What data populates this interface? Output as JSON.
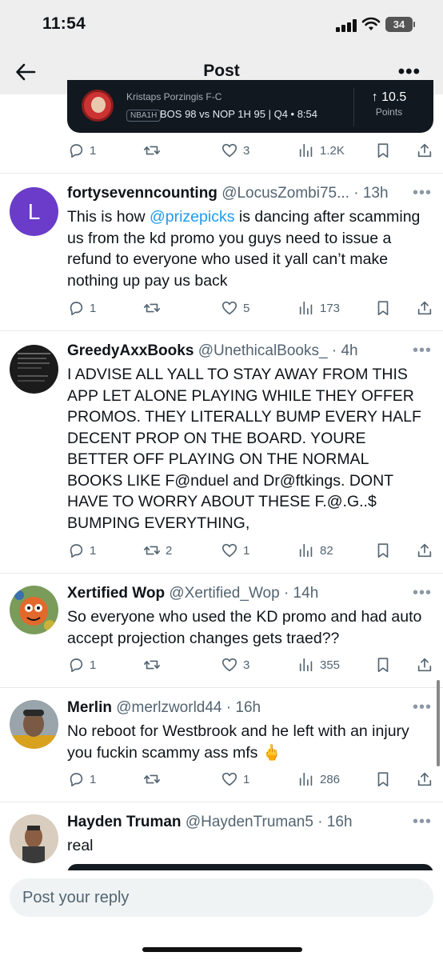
{
  "status": {
    "time": "11:54",
    "battery": "34"
  },
  "nav": {
    "title": "Post"
  },
  "card": {
    "player": "Kristaps Porzingis F-C",
    "league": "NBA1H",
    "score": "BOS 98 vs NOP 1H 95 | Q4 • 8:54",
    "line": "↑ 10.5",
    "unit": "Points"
  },
  "top_actions": {
    "replies": "1",
    "reposts": "",
    "likes": "3",
    "views": "1.2K"
  },
  "tweets": [
    {
      "name": "fortysevenncounting",
      "handle": "@LocusZombi75... · 13h",
      "avatar_letter": "L",
      "body_pre": "This is how ",
      "mention": "@prizepicks",
      "body_post": " is dancing after scamming us from the kd promo you guys need to issue a refund to everyone who used it yall can’t make nothing up pay us back",
      "replies": "1",
      "reposts": "",
      "likes": "5",
      "views": "173"
    },
    {
      "name": "GreedyAxxBooks",
      "handle": "@UnethicalBooks_ · 4h",
      "body": "I ADVISE ALL YALL TO STAY AWAY FROM THIS APP LET ALONE PLAYING WHILE THEY OFFER PROMOS. THEY LITERALLY BUMP EVERY HALF DECENT PROP ON THE BOARD. YOURE BETTER OFF PLAYING ON THE NORMAL BOOKS LIKE F@nduel and Dr@ftkings. DONT HAVE TO WORRY ABOUT THESE F.@.G..$  BUMPING EVERYTHING,",
      "replies": "1",
      "reposts": "2",
      "likes": "1",
      "views": "82"
    },
    {
      "name": "Xertified Wop",
      "handle": "@Xertified_Wop · 14h",
      "body": "So everyone who used the KD promo and had auto accept projection changes gets traed??",
      "replies": "1",
      "reposts": "",
      "likes": "3",
      "views": "355"
    },
    {
      "name": "Merlin",
      "handle": "@merlzworld44 · 16h",
      "body": "No reboot for Westbrook and he left with an injury you fuckin scammy ass mfs 🖕",
      "replies": "1",
      "reposts": "",
      "likes": "1",
      "views": "286"
    },
    {
      "name": "Hayden Truman",
      "handle": "@HaydenTruman5 · 16h",
      "body": "real"
    }
  ],
  "reply": {
    "placeholder": "Post your reply"
  },
  "colors": {
    "link": "#1d9bf0",
    "muted": "#536471",
    "avatar_l": "#6a3cc9"
  }
}
